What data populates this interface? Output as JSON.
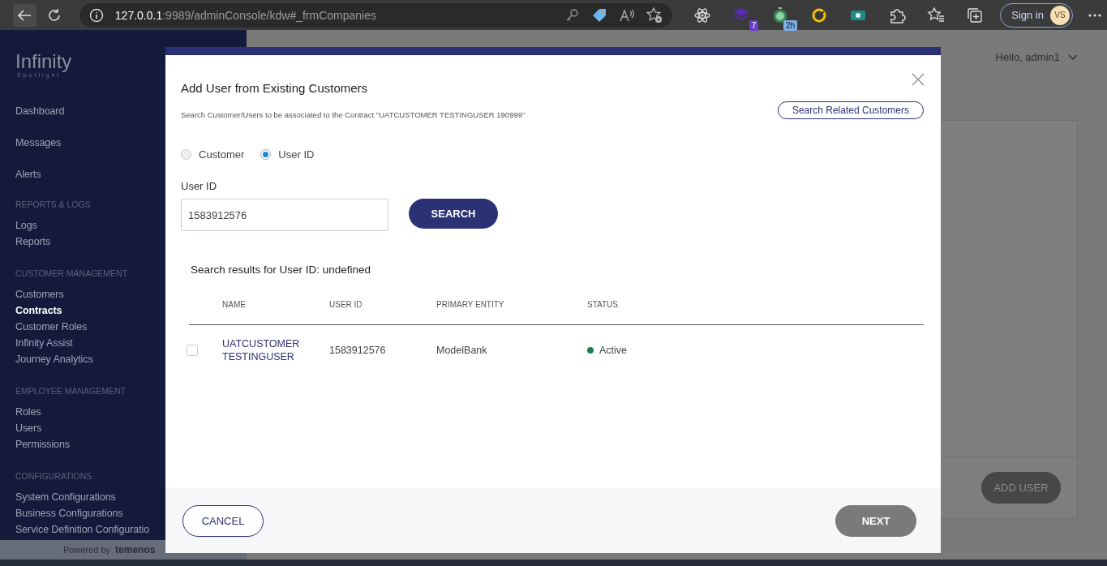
{
  "browser": {
    "url_host": "127.0.0.1",
    "url_path": ":9989/adminConsole/kdw#_frmCompanies",
    "extension_badges": [
      "7",
      "2h"
    ],
    "sign_in": "Sign in",
    "avatar": "VS"
  },
  "sidebar": {
    "logo": "Infinity",
    "logo_sub": "Spotlight",
    "items": [
      {
        "label": "Dashboard",
        "kind": "top",
        "selected": false
      },
      {
        "label": "Messages",
        "kind": "top",
        "selected": false
      },
      {
        "label": "Alerts",
        "kind": "top",
        "selected": false
      },
      {
        "label": "REPORTS & LOGS",
        "kind": "heading"
      },
      {
        "label": "Logs",
        "kind": "link",
        "selected": false
      },
      {
        "label": "Reports",
        "kind": "link",
        "selected": false
      },
      {
        "label": "CUSTOMER MANAGEMENT",
        "kind": "heading"
      },
      {
        "label": "Customers",
        "kind": "link",
        "selected": false
      },
      {
        "label": "Contracts",
        "kind": "link",
        "selected": true
      },
      {
        "label": "Customer Roles",
        "kind": "link",
        "selected": false
      },
      {
        "label": "Infinity Assist",
        "kind": "link",
        "selected": false
      },
      {
        "label": "Journey Analytics",
        "kind": "link",
        "selected": false
      },
      {
        "label": "EMPLOYEE MANAGEMENT",
        "kind": "heading"
      },
      {
        "label": "Roles",
        "kind": "link",
        "selected": false
      },
      {
        "label": "Users",
        "kind": "link",
        "selected": false
      },
      {
        "label": "Permissions",
        "kind": "link",
        "selected": false
      },
      {
        "label": "CONFIGURATIONS",
        "kind": "heading"
      },
      {
        "label": "System Configurations",
        "kind": "link",
        "selected": false
      },
      {
        "label": "Business Configurations",
        "kind": "link",
        "selected": false
      },
      {
        "label": "Service Definition Configuratio",
        "kind": "link",
        "selected": false
      }
    ],
    "footer_prefix": "Powered by",
    "footer_brand": "temenos"
  },
  "header": {
    "greeting": "Hello, admin1"
  },
  "page": {
    "add_button": "ADD USER"
  },
  "modal": {
    "title": "Add User from Existing Customers",
    "subtitle": "Search Customer/Users to be associated to the Contract \"UATCUSTOMER TESTINGUSER 190999\"",
    "related_button": "Search Related Customers",
    "radios": [
      {
        "label": "Customer",
        "selected": false
      },
      {
        "label": "User ID",
        "selected": true
      }
    ],
    "field_label": "User ID",
    "field_value": "1583912576",
    "search_button": "SEARCH",
    "results_title": "Search results for User ID: undefined",
    "columns": [
      "NAME",
      "USER ID",
      "PRIMARY ENTITY",
      "STATUS"
    ],
    "rows": [
      {
        "checked": false,
        "name": "UATCUSTOMER TESTINGUSER",
        "user_id": "1583912576",
        "entity": "ModelBank",
        "status": "Active",
        "color": "#1e7f4f"
      }
    ],
    "cancel_button": "CANCEL",
    "next_button": "NEXT"
  }
}
